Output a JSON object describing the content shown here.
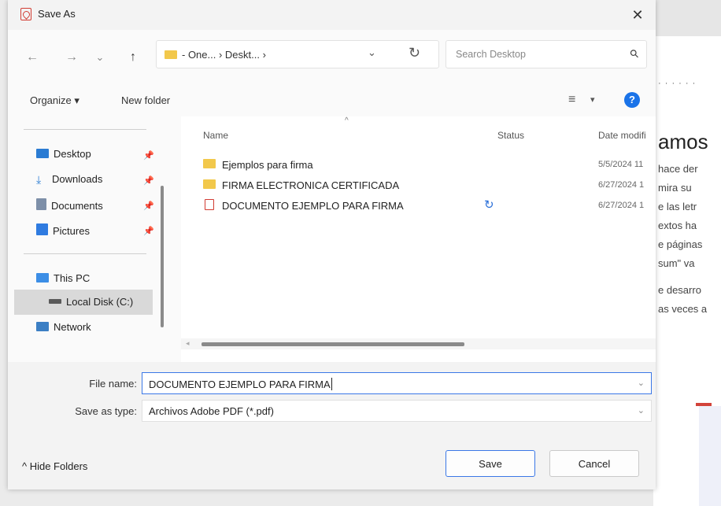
{
  "dialog": {
    "title": "Save As",
    "close": "✕"
  },
  "nav": {
    "back": "←",
    "forward": "→",
    "recent": "⌄",
    "up": "↑",
    "address": "- One... › Deskt... ›",
    "address_dropdown": "⌄",
    "refresh": "↻",
    "search_placeholder": "Search Desktop"
  },
  "toolbar": {
    "organize": "Organize ▾",
    "new_folder": "New folder",
    "view": "≡",
    "view_dropdown": "▾",
    "help": "?"
  },
  "sidebar": {
    "items": [
      {
        "label": "Desktop",
        "pinned": "📌"
      },
      {
        "label": "Downloads",
        "pinned": "📌"
      },
      {
        "label": "Documents",
        "pinned": "📌"
      },
      {
        "label": "Pictures",
        "pinned": "📌"
      },
      {
        "label": "This PC"
      },
      {
        "label": "Local Disk (C:)"
      },
      {
        "label": "Network"
      }
    ]
  },
  "files": {
    "columns": {
      "name": "Name",
      "status": "Status",
      "date": "Date modifi"
    },
    "rows": [
      {
        "name": "Ejemplos para firma",
        "type": "folder",
        "status": "",
        "date": "5/5/2024 11"
      },
      {
        "name": "FIRMA ELECTRONICA CERTIFICADA",
        "type": "folder",
        "status": "",
        "date": "6/27/2024 1"
      },
      {
        "name": "DOCUMENTO EJEMPLO PARA FIRMA",
        "type": "pdf",
        "status": "↻",
        "date": "6/27/2024 1"
      }
    ]
  },
  "form": {
    "file_name_label": "File name:",
    "file_name_value": "DOCUMENTO EJEMPLO PARA FIRMA",
    "save_type_label": "Save as type:",
    "save_type_value": "Archivos Adobe PDF (*.pdf)",
    "dropdown": "⌄"
  },
  "footer": {
    "hide_folders": "^ Hide Folders",
    "save": "Save",
    "cancel": "Cancel"
  },
  "background": {
    "heading": "amos",
    "dots": "· · · · · ·",
    "lines": [
      "hace der",
      "mira su",
      "e las letr",
      "extos ha",
      "e páginas",
      "sum\" va",
      "e desarro",
      "as veces a"
    ]
  },
  "colors": {
    "accent": "#3b78e7",
    "pdf_red": "#d13c32",
    "folder_yellow": "#f2c84b",
    "help_blue": "#1a73e8"
  }
}
